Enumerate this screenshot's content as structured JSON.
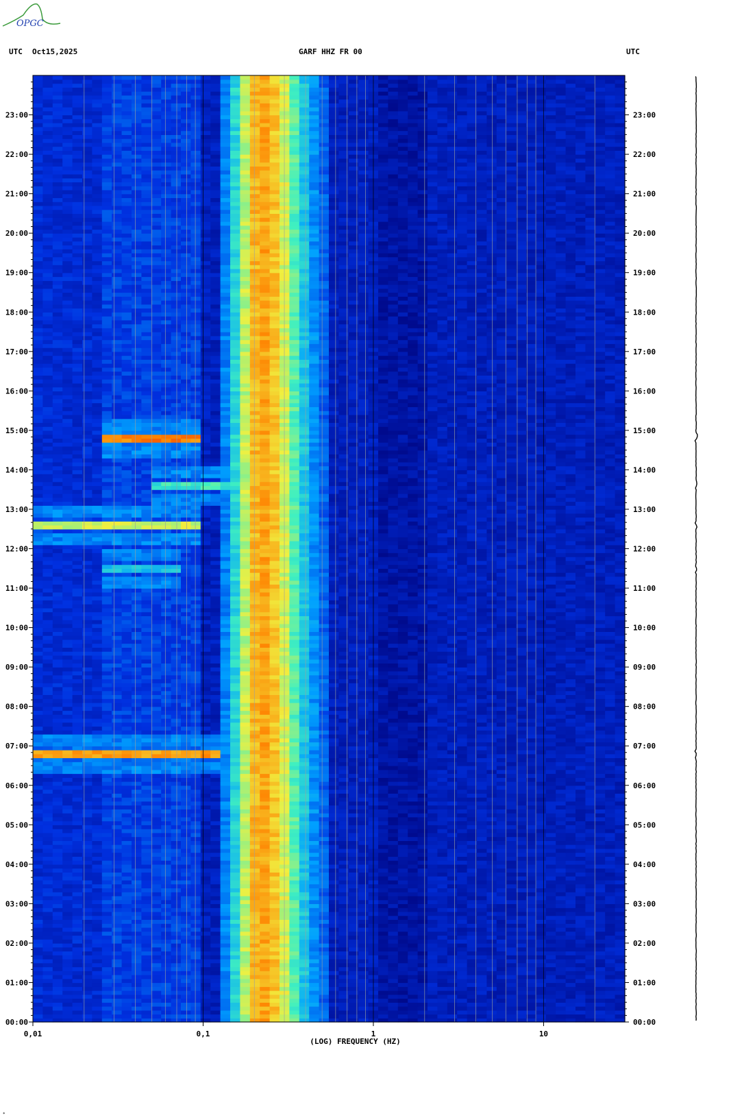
{
  "header": {
    "left_tz": "UTC",
    "date": "Oct15,2025",
    "station": "GARF HHZ FR 00",
    "right_tz": "UTC"
  },
  "logo": {
    "text": "OPGC"
  },
  "corner_mark": "*",
  "chart_data": {
    "type": "heatmap",
    "title": "GARF HHZ FR 00",
    "date": "Oct15,2025",
    "xlabel": "(LOG) FREQUENCY (HZ)",
    "ylabel": "UTC",
    "x_scale": "log",
    "xlim": [
      0.01,
      30
    ],
    "x_tick_labels": [
      {
        "value": 0.01,
        "label": "0,01"
      },
      {
        "value": 0.1,
        "label": "0,1"
      },
      {
        "value": 1,
        "label": "1"
      },
      {
        "value": 10,
        "label": "10"
      }
    ],
    "ylim_hours": [
      0,
      24
    ],
    "y_tick_labels": [
      "00:00",
      "01:00",
      "02:00",
      "03:00",
      "04:00",
      "05:00",
      "06:00",
      "07:00",
      "08:00",
      "09:00",
      "10:00",
      "11:00",
      "12:00",
      "13:00",
      "14:00",
      "15:00",
      "16:00",
      "17:00",
      "18:00",
      "19:00",
      "20:00",
      "21:00",
      "22:00",
      "23:00"
    ],
    "colormap": [
      "#000a8c",
      "#0030e0",
      "#00a0ff",
      "#40f0c0",
      "#f0f040",
      "#ff8000",
      "#e01010",
      "#a00000"
    ],
    "background_level": 0.08,
    "microseism_band": {
      "from_hz": 0.12,
      "to_hz": 0.55,
      "peak_hz": 0.22,
      "peak_level": 0.55
    },
    "events": [
      {
        "time": "06:48",
        "from_hz": 0.01,
        "to_hz": 0.12,
        "level": 0.9
      },
      {
        "time": "11:30",
        "from_hz": 0.025,
        "to_hz": 0.07,
        "level": 0.45
      },
      {
        "time": "12:36",
        "from_hz": 0.01,
        "to_hz": 0.1,
        "level": 0.72
      },
      {
        "time": "13:36",
        "from_hz": 0.05,
        "to_hz": 0.3,
        "level": 0.55
      },
      {
        "time": "14:48",
        "from_hz": 0.025,
        "to_hz": 0.1,
        "level": 0.95
      }
    ],
    "grid": true
  },
  "colors": {
    "background": "#ffffff",
    "grid_line": "#9aa0a0",
    "text": "#000000",
    "logo_green": "#3a9a3a",
    "logo_blue": "#2040b0"
  }
}
